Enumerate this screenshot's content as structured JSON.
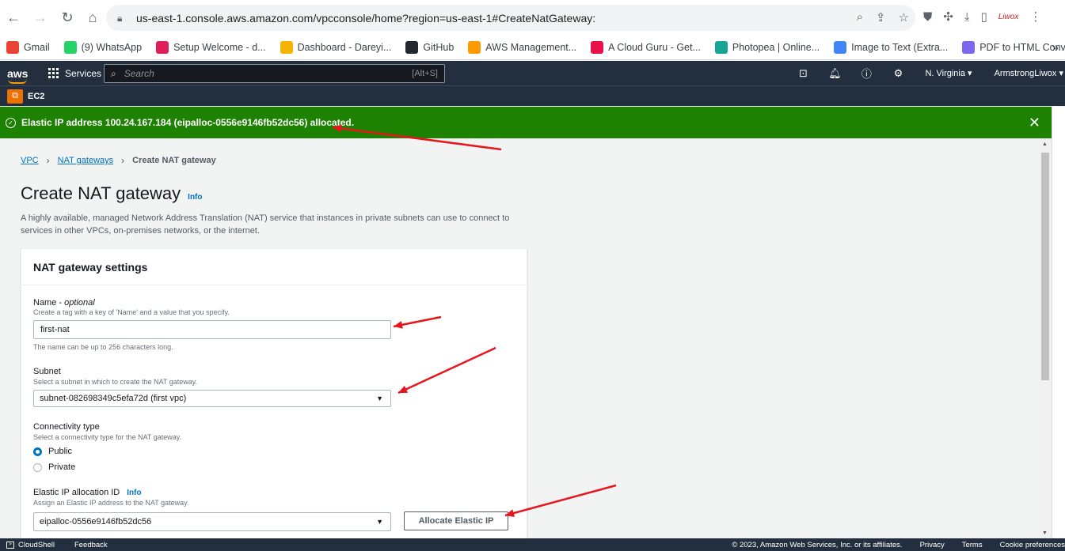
{
  "browser": {
    "url": "us-east-1.console.aws.amazon.com/vpcconsole/home?region=us-east-1#CreateNatGateway:",
    "bookmarks": [
      {
        "label": "Gmail",
        "color": "#ea4335"
      },
      {
        "label": "(9) WhatsApp",
        "color": "#25d366"
      },
      {
        "label": "Setup Welcome - d...",
        "color": "#e01e5a"
      },
      {
        "label": "Dashboard - Dareyi...",
        "color": "#f4b400"
      },
      {
        "label": "GitHub",
        "color": "#24292e"
      },
      {
        "label": "AWS Management...",
        "color": "#ff9900"
      },
      {
        "label": "A Cloud Guru - Get...",
        "color": "#e8114b"
      },
      {
        "label": "Photopea | Online...",
        "color": "#18a497"
      },
      {
        "label": "Image to Text (Extra...",
        "color": "#4285f4"
      },
      {
        "label": "PDF to HTML Conv...",
        "color": "#7b68ee"
      }
    ]
  },
  "aws_header": {
    "logo": "aws",
    "services_label": "Services",
    "search_placeholder": "Search",
    "search_shortcut": "[Alt+S]",
    "region": "N. Virginia ▾",
    "account": "ArmstrongLiwox ▾",
    "service_badge": "EC2"
  },
  "flash": {
    "message": "Elastic IP address 100.24.167.184 (eipalloc-0556e9146fb52dc56) allocated.",
    "color": "#1d8102"
  },
  "breadcrumb": {
    "items": [
      "VPC",
      "NAT gateways"
    ],
    "current": "Create NAT gateway"
  },
  "page": {
    "title": "Create NAT gateway",
    "info": "Info",
    "description": "A highly available, managed Network Address Translation (NAT) service that instances in private subnets can use to connect to services in other VPCs, on-premises networks, or the internet."
  },
  "panel": {
    "header": "NAT gateway settings",
    "name": {
      "label": "Name - ",
      "label_optional": "optional",
      "description": "Create a tag with a key of 'Name' and a value that you specify.",
      "value": "first-nat",
      "constraint": "The name can be up to 256 characters long."
    },
    "subnet": {
      "label": "Subnet",
      "description": "Select a subnet in which to create the NAT gateway.",
      "value": "subnet-082698349c5efa72d (first vpc)"
    },
    "connectivity": {
      "label": "Connectivity type",
      "description": "Select a connectivity type for the NAT gateway.",
      "options": [
        "Public",
        "Private"
      ],
      "selected": "Public"
    },
    "eip": {
      "label": "Elastic IP allocation ID",
      "info": "Info",
      "description": "Assign an Elastic IP address to the NAT gateway.",
      "value": "eipalloc-0556e9146fb52dc56",
      "button": "Allocate Elastic IP"
    }
  },
  "footer": {
    "cloudshell": "CloudShell",
    "feedback": "Feedback",
    "copyright": "© 2023, Amazon Web Services, Inc. or its affiliates.",
    "privacy": "Privacy",
    "terms": "Terms",
    "cookies": "Cookie preferences"
  },
  "annotation_color": "#e8161c"
}
